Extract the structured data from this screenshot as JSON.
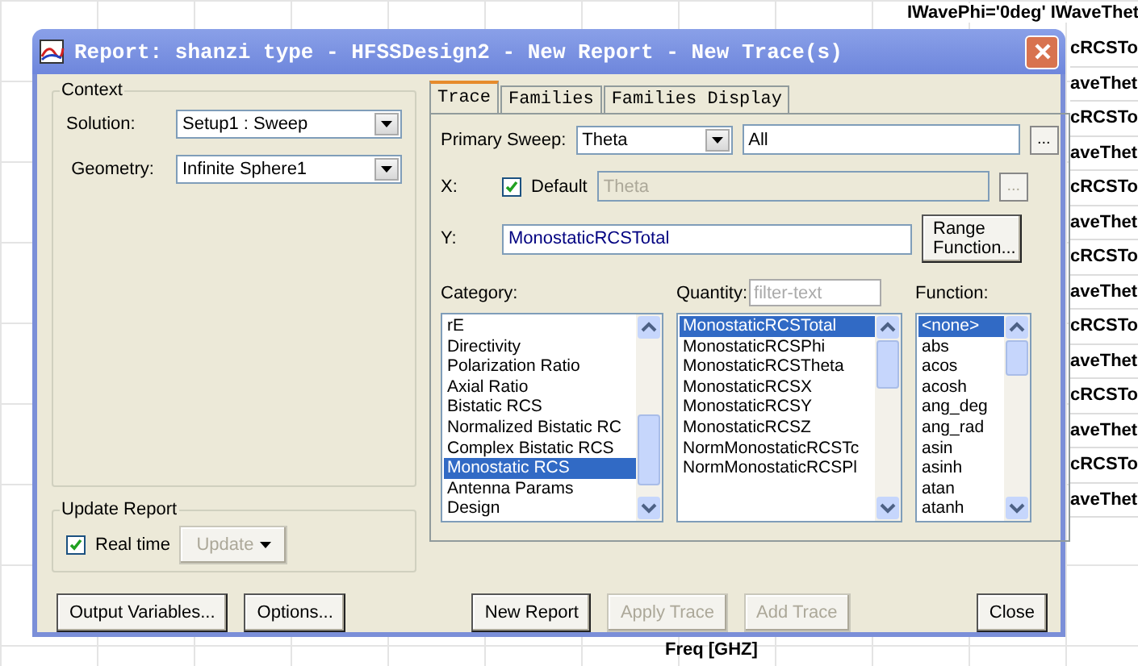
{
  "background": {
    "legend_header": "IWavePhi='0deg' IWaveThet",
    "legend_entries": [
      "cRCSTo",
      "aveThet",
      "cRCSTo",
      "aveThet",
      "cRCSTo",
      "aveThet",
      "cRCSTo",
      "aveThet",
      "cRCSTo",
      "aveThet",
      "cRCSTo",
      "aveThet",
      "cRCSTo",
      "aveThet"
    ],
    "x_axis_label": "Freq [GHZ]"
  },
  "window": {
    "title": "Report: shanzi type - HFSSDesign2 - New Report - New Trace(s)"
  },
  "context": {
    "title": "Context",
    "solution_label": "Solution:",
    "solution": "Setup1 : Sweep",
    "geometry_label": "Geometry:",
    "geometry": "Infinite Sphere1"
  },
  "update_report": {
    "title": "Update Report",
    "real_time_label": "Real time",
    "real_time_checked": true,
    "update_button": "Update",
    "update_disabled": true
  },
  "tabs": [
    {
      "label": "Trace",
      "selected": true
    },
    {
      "label": "Families",
      "selected": false
    },
    {
      "label": "Families Display",
      "selected": false
    }
  ],
  "trace": {
    "primary_sweep_label": "Primary Sweep:",
    "primary_sweep": "Theta",
    "sweep_range": "All",
    "browse_button": "...",
    "x_label": "X:",
    "x_default_label": "Default",
    "x_default_checked": true,
    "x_value": "Theta",
    "x_browse_button": "...",
    "y_label": "Y:",
    "y_value": "MonostaticRCSTotal",
    "range_button": "Range Function...",
    "category_label": "Category:",
    "quantity_label": "Quantity:",
    "quantity_filter_placeholder": "filter-text",
    "function_label": "Function:",
    "categories": [
      {
        "label": "rE",
        "selected": false
      },
      {
        "label": "Directivity",
        "selected": false
      },
      {
        "label": "Polarization Ratio",
        "selected": false
      },
      {
        "label": "Axial Ratio",
        "selected": false
      },
      {
        "label": "Bistatic RCS",
        "selected": false
      },
      {
        "label": "Normalized Bistatic RC",
        "selected": false
      },
      {
        "label": "Complex Bistatic RCS",
        "selected": false
      },
      {
        "label": "Monostatic RCS",
        "selected": true
      },
      {
        "label": "Antenna Params",
        "selected": false
      },
      {
        "label": "Design",
        "selected": false
      }
    ],
    "quantities": [
      {
        "label": "MonostaticRCSTotal",
        "selected": true
      },
      {
        "label": "MonostaticRCSPhi",
        "selected": false
      },
      {
        "label": "MonostaticRCSTheta",
        "selected": false
      },
      {
        "label": "MonostaticRCSX",
        "selected": false
      },
      {
        "label": "MonostaticRCSY",
        "selected": false
      },
      {
        "label": "MonostaticRCSZ",
        "selected": false
      },
      {
        "label": "NormMonostaticRCSTc",
        "selected": false
      },
      {
        "label": "NormMonostaticRCSPl",
        "selected": false
      }
    ],
    "functions": [
      {
        "label": "<none>",
        "selected": true
      },
      {
        "label": "abs",
        "selected": false
      },
      {
        "label": "acos",
        "selected": false
      },
      {
        "label": "acosh",
        "selected": false
      },
      {
        "label": "ang_deg",
        "selected": false
      },
      {
        "label": "ang_rad",
        "selected": false
      },
      {
        "label": "asin",
        "selected": false
      },
      {
        "label": "asinh",
        "selected": false
      },
      {
        "label": "atan",
        "selected": false
      },
      {
        "label": "atanh",
        "selected": false
      }
    ]
  },
  "left_buttons": [
    {
      "label": "Output Variables...",
      "disabled": false
    },
    {
      "label": "Options...",
      "disabled": false
    }
  ],
  "right_buttons": [
    {
      "label": "New Report",
      "disabled": false
    },
    {
      "label": "Apply Trace",
      "disabled": true
    },
    {
      "label": "Add Trace",
      "disabled": true
    }
  ],
  "close_button": "Close"
}
